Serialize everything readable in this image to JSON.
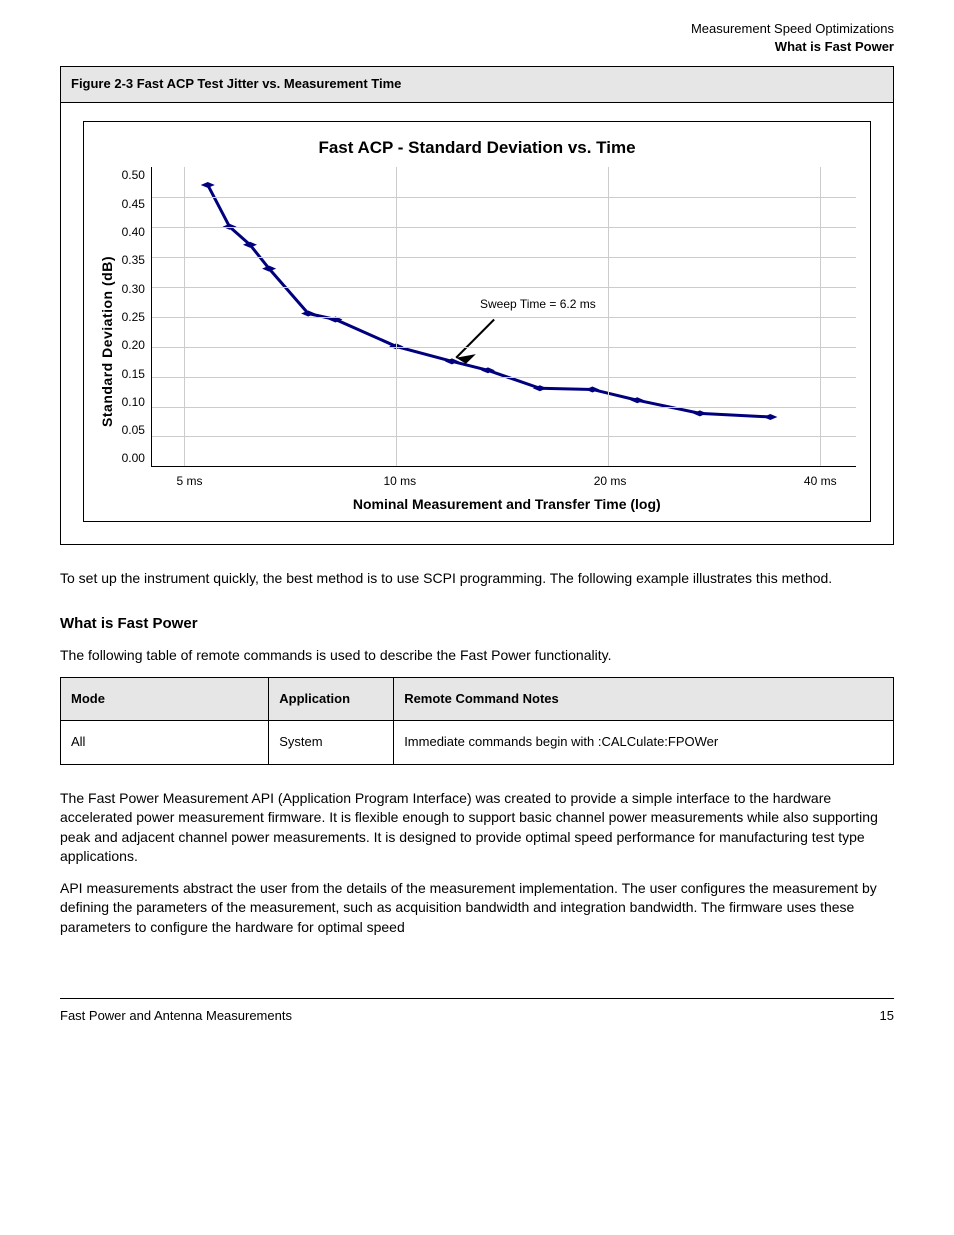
{
  "page_header": {
    "line1": "Measurement Speed Optimizations",
    "line2": "What is Fast Power"
  },
  "figure": {
    "caption": "Figure 2-3 Fast ACP Test Jitter vs. Measurement Time"
  },
  "chart_data": {
    "type": "line",
    "title": "Fast ACP - Standard Deviation vs. Time",
    "xlabel": "Nominal Measurement and Transfer Time (log)",
    "ylabel": "Standard Deviation (dB)",
    "ylim": [
      0.0,
      0.5
    ],
    "yticks": [
      "0.50",
      "0.45",
      "0.40",
      "0.35",
      "0.30",
      "0.25",
      "0.20",
      "0.15",
      "0.10",
      "0.05",
      "0.00"
    ],
    "xticks": [
      {
        "label": "5 ms",
        "val": 5
      },
      {
        "label": "10 ms",
        "val": 10
      },
      {
        "label": "20 ms",
        "val": 20
      },
      {
        "label": "40 ms",
        "val": 40
      }
    ],
    "x_log_range": [
      4.5,
      45
    ],
    "points": [
      {
        "x": 5.4,
        "y": 0.47
      },
      {
        "x": 5.8,
        "y": 0.4
      },
      {
        "x": 6.2,
        "y": 0.37
      },
      {
        "x": 6.6,
        "y": 0.33
      },
      {
        "x": 7.5,
        "y": 0.255
      },
      {
        "x": 8.2,
        "y": 0.245
      },
      {
        "x": 10.0,
        "y": 0.2
      },
      {
        "x": 12.0,
        "y": 0.175
      },
      {
        "x": 13.5,
        "y": 0.16
      },
      {
        "x": 16.0,
        "y": 0.13
      },
      {
        "x": 19.0,
        "y": 0.128
      },
      {
        "x": 22.0,
        "y": 0.11
      },
      {
        "x": 27.0,
        "y": 0.088
      },
      {
        "x": 34.0,
        "y": 0.082
      }
    ],
    "annotation": {
      "text": "Sweep Time = 6.2 ms",
      "target_x": 12.0,
      "target_y": 0.175
    }
  },
  "body": {
    "para1": "To set up the instrument quickly, the best method is to use SCPI programming. The following example illustrates this method.",
    "heading": "What is Fast Power",
    "para2": "The following table of remote commands is used to describe the Fast Power functionality."
  },
  "cmd_table": {
    "headers": [
      "Mode",
      "Application",
      "Remote Command Notes"
    ],
    "row": {
      "mode": "All",
      "application": "System",
      "notes": "Immediate commands begin with :CALCulate:FPOWer"
    }
  },
  "contents": {
    "para1": "The Fast Power Measurement API (Application Program Interface) was created to provide a simple interface to the hardware accelerated power measurement firmware. It is flexible enough to support basic channel power measurements while also supporting peak and adjacent channel power measurements. It is designed to provide optimal speed performance for manufacturing test type applications.",
    "para2": "API measurements abstract the user from the details of the measurement implementation. The user configures the measurement by defining the parameters of the measurement, such as acquisition bandwidth and integration bandwidth. The firmware uses these parameters to configure the hardware for optimal speed"
  },
  "footer": {
    "left": "Fast Power and Antenna Measurements",
    "right": "15"
  }
}
